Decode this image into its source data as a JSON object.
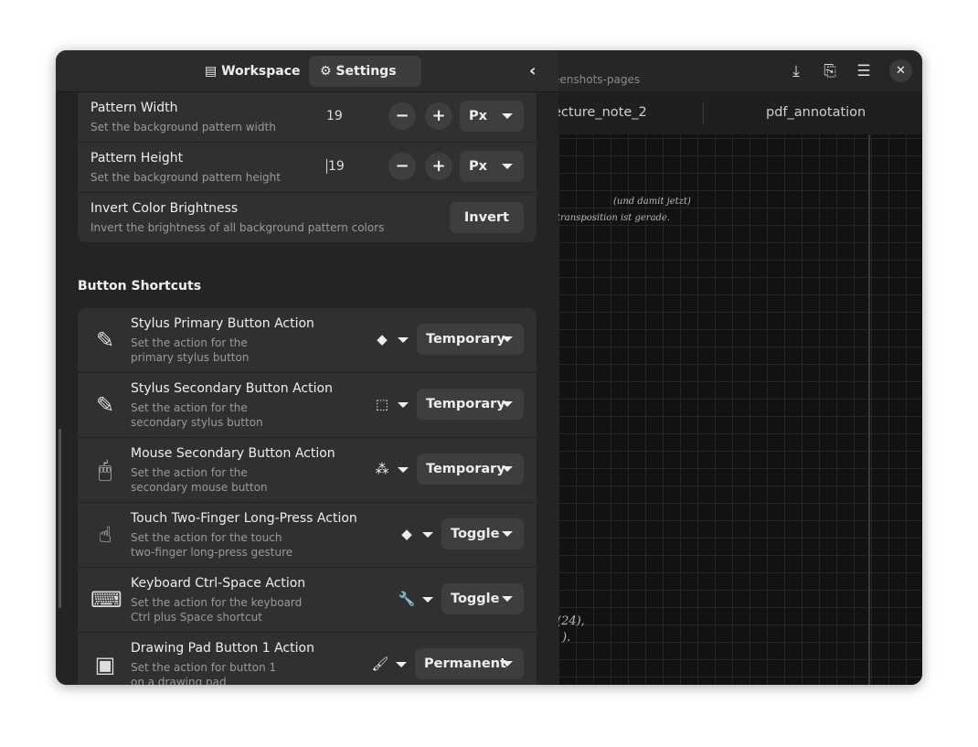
{
  "header": {
    "tabs": [
      {
        "label": "Workspace",
        "icon": "workspace-icon"
      },
      {
        "label": "Settings",
        "icon": "gear-icon",
        "active": true
      }
    ],
    "collapse_icon": "chevron-left-icon"
  },
  "document": {
    "title": "eenshots-pages",
    "tabs": [
      "ecture_note_2",
      "pdf_annotation"
    ],
    "actions": [
      "download-icon",
      "document-search-icon",
      "menu-icon",
      "close-icon"
    ],
    "handwriting": [
      "(und damit jetzt)",
      "transposition ist gerade.",
      "(24),",
      ")."
    ]
  },
  "background": {
    "rows": [
      {
        "title": "Pattern Width",
        "subtitle": "Set the background pattern width",
        "value": "19",
        "unit": "Px"
      },
      {
        "title": "Pattern Height",
        "subtitle": "Set the background pattern height",
        "value": "19",
        "unit": "Px"
      },
      {
        "title": "Invert Color Brightness",
        "subtitle": "Invert the brightness of all background pattern colors",
        "button": "Invert"
      }
    ]
  },
  "shortcuts": {
    "title": "Button Shortcuts",
    "rows": [
      {
        "title": "Stylus Primary Button Action",
        "subtitle1": "Set the action for the",
        "subtitle2": "primary stylus button",
        "icon": "stylus-icon",
        "tool": "eraser-icon",
        "mode": "Temporary"
      },
      {
        "title": "Stylus Secondary Button Action",
        "subtitle1": "Set the action for the",
        "subtitle2": "secondary stylus button",
        "icon": "stylus-icon",
        "tool": "selector-icon",
        "mode": "Temporary"
      },
      {
        "title": "Mouse Secondary Button Action",
        "subtitle1": "Set the action for the",
        "subtitle2": "secondary mouse button",
        "icon": "mouse-icon",
        "tool": "shapes-icon",
        "mode": "Temporary"
      },
      {
        "title": "Touch Two-Finger Long-Press Action",
        "subtitle1": "Set the action for the touch",
        "subtitle2": "two-finger long-press gesture",
        "icon": "touch-icon",
        "tool": "eraser-icon",
        "mode": "Toggle"
      },
      {
        "title": "Keyboard Ctrl-Space Action",
        "subtitle1": "Set the action for the keyboard",
        "subtitle2": "Ctrl plus Space shortcut",
        "icon": "keyboard-icon",
        "tool": "wrench-icon",
        "mode": "Toggle"
      },
      {
        "title": "Drawing Pad Button 1 Action",
        "subtitle1": "Set the action for button 1",
        "subtitle2": "on a drawing pad",
        "icon": "drawing-pad-icon",
        "tool": "brush-icon",
        "mode": "Permanent"
      }
    ]
  }
}
